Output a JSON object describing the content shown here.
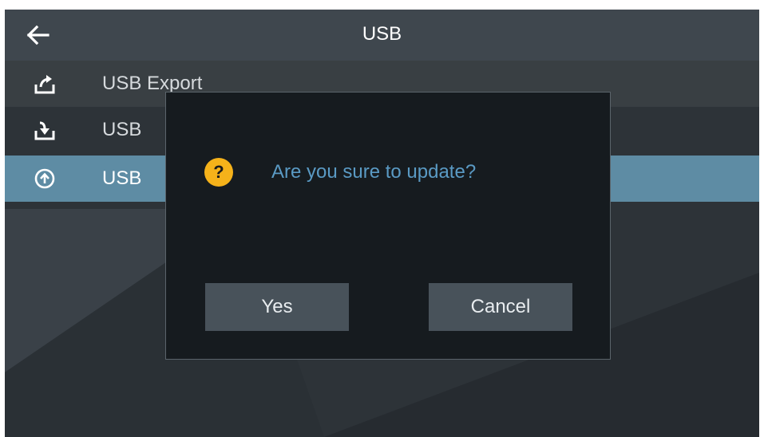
{
  "header": {
    "title": "USB",
    "back_icon": "arrow-left-icon"
  },
  "menu": {
    "items": [
      {
        "label": "USB Export",
        "icon": "upload-tray-icon",
        "selected": false
      },
      {
        "label": "USB",
        "icon": "download-tray-icon",
        "selected": false
      },
      {
        "label": "USB",
        "icon": "circle-up-arrow-icon",
        "selected": true
      }
    ]
  },
  "dialog": {
    "icon": "question-icon",
    "icon_glyph": "?",
    "message": "Are you sure to update?",
    "yes_label": "Yes",
    "cancel_label": "Cancel"
  },
  "colors": {
    "header_bg": "#3f474e",
    "selected_row": "#5e8ca4",
    "dialog_bg": "#161b1f",
    "message_text": "#5a9ac4",
    "warning_icon": "#f5b21a",
    "button_bg": "#48525a"
  }
}
